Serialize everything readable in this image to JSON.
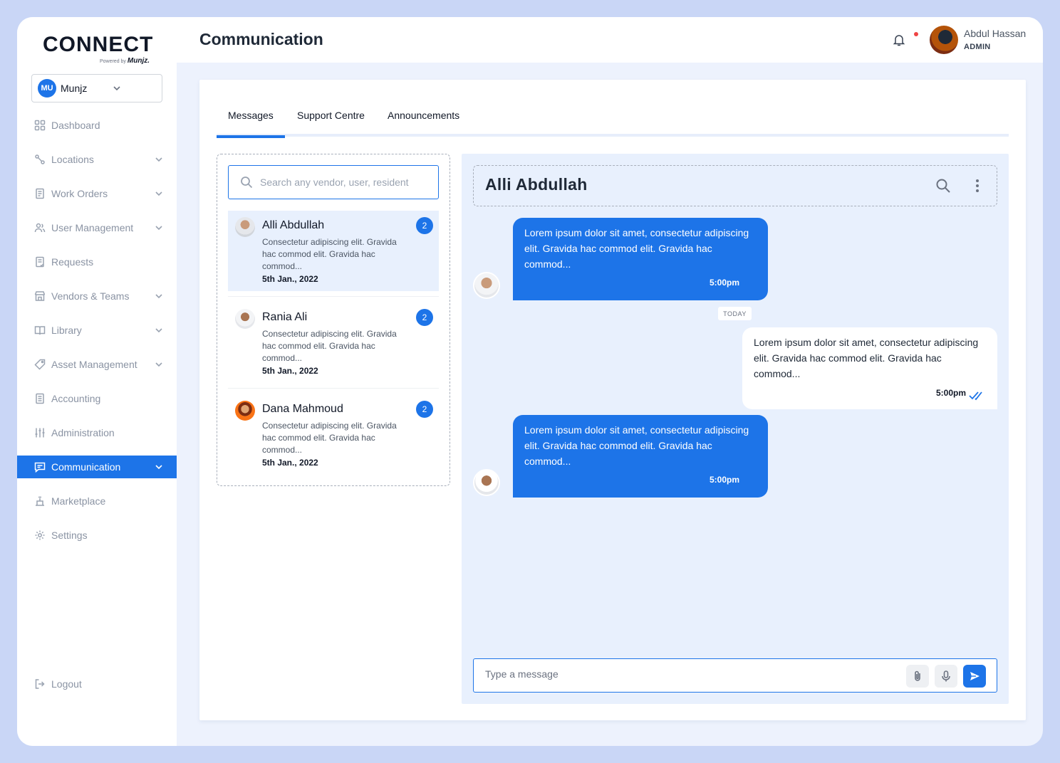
{
  "brand": {
    "logo_text": "CONNECT",
    "logo_sub": "Powered by",
    "logo_sub_brand": "Munjz."
  },
  "org": {
    "initials": "MU",
    "name": "Munjz"
  },
  "sidebar": {
    "items": [
      {
        "label": "Dashboard",
        "icon": "grid-icon",
        "chevron": false
      },
      {
        "label": "Locations",
        "icon": "location-icon",
        "chevron": true
      },
      {
        "label": "Work Orders",
        "icon": "document-icon",
        "chevron": true
      },
      {
        "label": "User Management",
        "icon": "users-icon",
        "chevron": true
      },
      {
        "label": "Requests",
        "icon": "clipboard-icon",
        "chevron": false
      },
      {
        "label": "Vendors & Teams",
        "icon": "store-icon",
        "chevron": true
      },
      {
        "label": "Library",
        "icon": "book-icon",
        "chevron": true
      },
      {
        "label": "Asset Management",
        "icon": "tag-icon",
        "chevron": true
      },
      {
        "label": "Accounting",
        "icon": "ledger-icon",
        "chevron": false
      },
      {
        "label": "Administration",
        "icon": "sliders-icon",
        "chevron": false
      },
      {
        "label": "Communication",
        "icon": "chat-icon",
        "chevron": true,
        "active": true
      },
      {
        "label": "Marketplace",
        "icon": "marketplace-icon",
        "chevron": false
      },
      {
        "label": "Settings",
        "icon": "gear-icon",
        "chevron": false
      }
    ],
    "logout_label": "Logout"
  },
  "header": {
    "title": "Communication",
    "user_name": "Abdul Hassan",
    "user_role": "ADMIN"
  },
  "tabs": [
    {
      "label": "Messages",
      "active": true
    },
    {
      "label": "Support Centre",
      "active": false
    },
    {
      "label": "Announcements",
      "active": false
    }
  ],
  "search": {
    "placeholder": "Search any vendor, user, resident"
  },
  "contacts": [
    {
      "name": "Alli Abdullah",
      "preview": "Consectetur adipiscing elit. Gravida hac commod elit. Gravida hac commod...",
      "date": "5th Jan., 2022",
      "unread": "2",
      "selected": true
    },
    {
      "name": "Rania Ali",
      "preview": "Consectetur adipiscing elit. Gravida hac commod elit. Gravida hac commod...",
      "date": "5th Jan., 2022",
      "unread": "2",
      "selected": false
    },
    {
      "name": "Dana Mahmoud",
      "preview": "Consectetur adipiscing elit. Gravida hac commod elit. Gravida hac commod...",
      "date": "5th Jan., 2022",
      "unread": "2",
      "selected": false
    }
  ],
  "chat": {
    "title": "Alli Abdullah",
    "divider_label": "TODAY",
    "messages": [
      {
        "direction": "incoming",
        "text": "Lorem ipsum dolor sit amet, consectetur adipiscing elit. Gravida hac commod elit. Gravida hac commod...",
        "time": "5:00pm"
      },
      {
        "direction": "outgoing",
        "text": "Lorem ipsum dolor sit amet, consectetur adipiscing elit. Gravida hac commod elit. Gravida hac commod...",
        "time": "5:00pm",
        "read": true
      },
      {
        "direction": "incoming",
        "text": "Lorem ipsum dolor sit amet, consectetur adipiscing elit. Gravida hac commod elit. Gravida hac commod...",
        "time": "5:00pm"
      }
    ],
    "composer_placeholder": "Type a message"
  },
  "colors": {
    "accent": "#1d74e8",
    "background": "#edf2fd",
    "frame": "#c9d6f6"
  }
}
